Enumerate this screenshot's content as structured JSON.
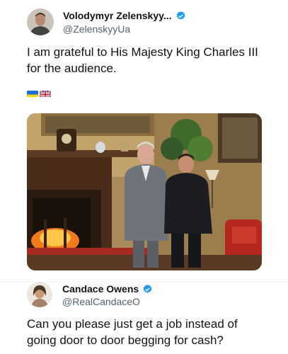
{
  "tweet1": {
    "author_name": "Volodymyr Zelenskyy...",
    "author_handle": "@ZelenskyyUa",
    "text": "I am grateful to His Majesty King Charles III for the audience.",
    "flags": [
      "ukraine-flag",
      "uk-flag"
    ],
    "photo": "King Charles III and Volodymyr Zelenskyy standing by a fireplace in a wood-paneled room"
  },
  "tweet2": {
    "author_name": "Candace Owens",
    "author_handle": "@RealCandaceO",
    "text": "Can you please just get a job instead of going door to door begging for cash?"
  },
  "colors": {
    "verified": "#1d9bf0",
    "handle": "#536471",
    "text": "#0f1419"
  }
}
